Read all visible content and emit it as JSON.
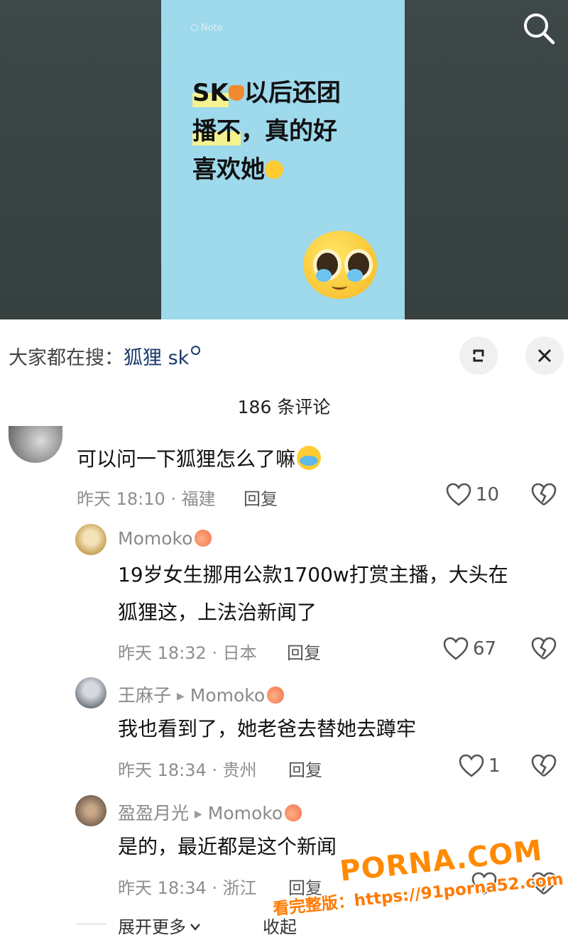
{
  "note": {
    "watermark": "Note",
    "line1_a": "SK",
    "line1_b": "以后还团",
    "line2_a": "播不",
    "line2_b": "，真的好",
    "line3": "喜欢她"
  },
  "trending": {
    "label": "大家都在搜：",
    "query": "狐狸 sk"
  },
  "comment_count": "186 条评论",
  "comments": [
    {
      "text": "可以问一下狐狸怎么了嘛",
      "time": "昨天 18:10 · 福建",
      "reply": "回复",
      "likes": "10"
    },
    {
      "user": "Momoko",
      "text_line1": "19岁女生挪用公款1700w打赏主播，大头在",
      "text_line2": "狐狸这，上法治新闻了",
      "time": "昨天 18:32 · 日本",
      "reply": "回复",
      "likes": "67"
    },
    {
      "user": "王麻子",
      "reply_to": "Momoko",
      "text": "我也看到了，她老爸去替她去蹲牢",
      "time": "昨天 18:34 · 贵州",
      "reply": "回复",
      "likes": "1"
    },
    {
      "user": "盈盈月光",
      "reply_to": "Momoko",
      "text": "是的，最近都是这个新闻",
      "time": "昨天 18:34 · 浙江",
      "reply": "回复"
    }
  ],
  "expand_more": "展开更多",
  "collapse": "收起",
  "watermark": {
    "logo": "PORNA.COM",
    "url": "看完整版：https://91porna52.com"
  },
  "icons": [
    "search-icon",
    "expand-icon",
    "close-icon",
    "heart-icon",
    "broken-heart-icon",
    "chevron-down-icon"
  ]
}
